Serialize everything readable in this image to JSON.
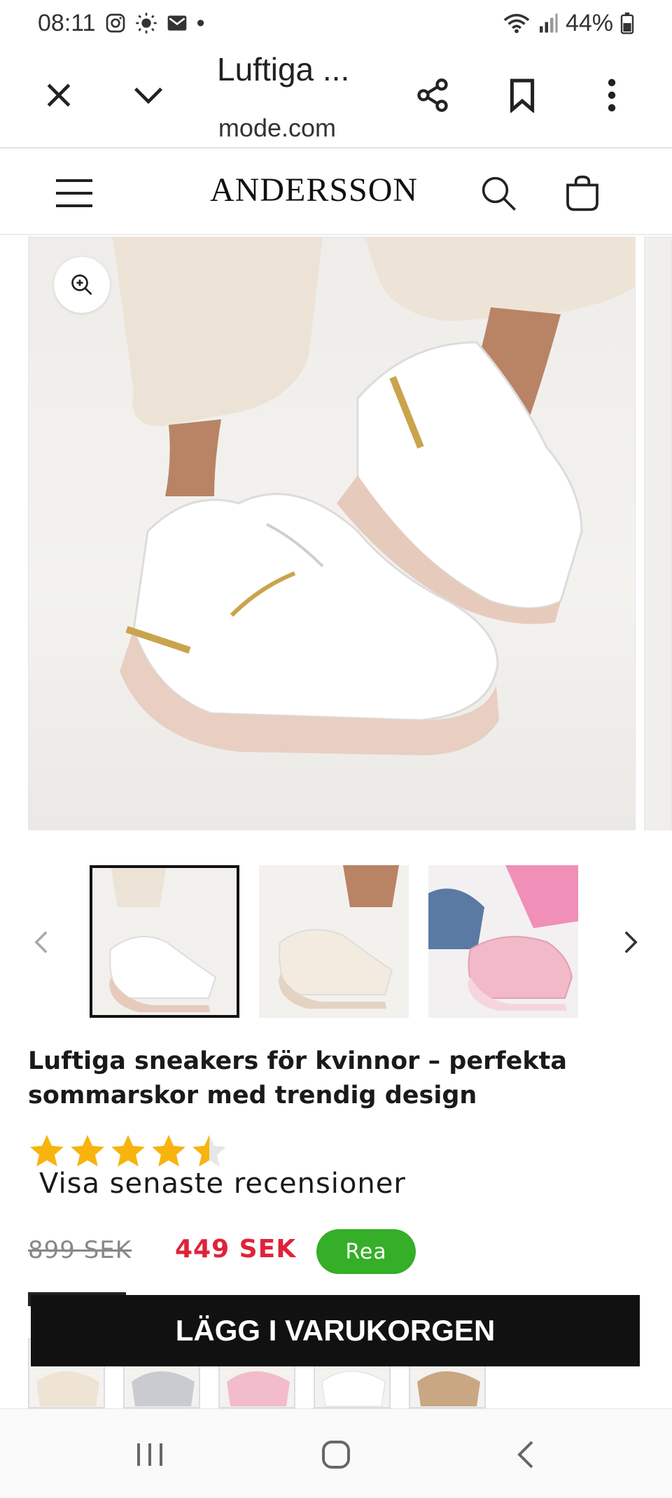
{
  "status_bar": {
    "time": "08:11",
    "dot": "•",
    "battery": "44%"
  },
  "browser": {
    "title": "Luftiga ...",
    "url": "anderssonmode.com",
    "icons": [
      "close-icon",
      "chevron-down-icon",
      "share-icon",
      "bookmark-icon",
      "more-vert-icon"
    ]
  },
  "site_header": {
    "brand": "ANDERSSON",
    "icons": [
      "menu-icon",
      "search-icon",
      "cart-icon"
    ]
  },
  "gallery": {
    "thumbnail_count": 3,
    "active_index": 0
  },
  "product": {
    "title": "Luftiga sneakers för kvinnor – perfekta sommarskor med trendig design",
    "rating": 4.5,
    "rating_max": 5,
    "reviews_link": "Visa senaste recensioner",
    "old_price": "899 SEK",
    "new_price": "449 SEK",
    "sale_badge": "Rea"
  },
  "cta": {
    "label": "LÄGG I VARUKORGEN"
  },
  "colors": {
    "price_red": "#e0223a",
    "badge_green": "#35ae28",
    "star_yellow": "#f7b40e",
    "cta_black": "#111111"
  }
}
